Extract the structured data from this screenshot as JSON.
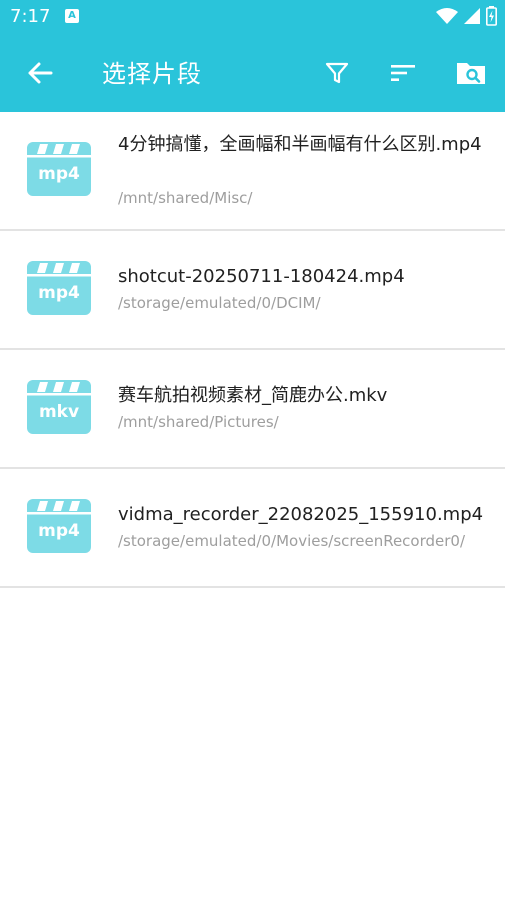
{
  "status_bar": {
    "time": "7:17"
  },
  "app_bar": {
    "title": "选择片段"
  },
  "files": [
    {
      "type_label": "mp4",
      "name": "4分钟搞懂，全画幅和半画幅有什么区别.mp4",
      "path": "/mnt/shared/Misc/"
    },
    {
      "type_label": "mp4",
      "name": "shotcut-20250711-180424.mp4",
      "path": "/storage/emulated/0/DCIM/"
    },
    {
      "type_label": "mkv",
      "name": "赛车航拍视频素材_简鹿办公.mkv",
      "path": "/mnt/shared/Pictures/"
    },
    {
      "type_label": "mp4",
      "name": "vidma_recorder_22082025_155910.mp4",
      "path": "/storage/emulated/0/Movies/screenRecorder0/"
    }
  ],
  "colors": {
    "primary": "#2ac4da",
    "thumb": "#7ddbe6",
    "divider": "#e3e3e3"
  },
  "icons": [
    "back-arrow-icon",
    "filter-icon",
    "sort-icon",
    "folder-search-icon",
    "wifi-icon",
    "signal-icon",
    "battery-icon",
    "video-file-icon"
  ]
}
